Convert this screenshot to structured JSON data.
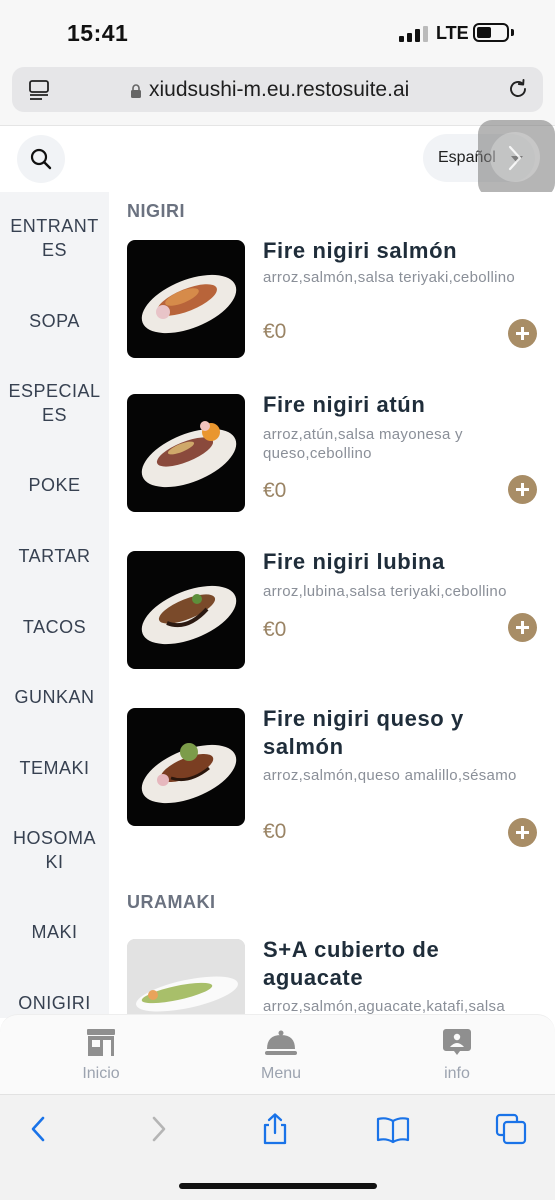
{
  "status_bar": {
    "time": "15:41",
    "network": "LTE"
  },
  "browser": {
    "url": "xiudsushi-m.eu.restosuite.ai"
  },
  "toolbar": {
    "language": "Español"
  },
  "categories": [
    "ENTRANT\nES",
    "SOPA",
    "ESPECIAL\nES",
    "POKE",
    "TARTAR",
    "TACOS",
    "GUNKAN",
    "TEMAKI",
    "HOSOMA\nKI",
    "MAKI",
    "ONIGIRI"
  ],
  "sections": [
    {
      "title": "NIGIRI",
      "items": [
        {
          "name": "Fire nigiri salmón",
          "description": "arroz,salmón,salsa teriyaki,cebollino",
          "price": "€0"
        },
        {
          "name": "Fire nigiri atún",
          "description": "arroz,atún,salsa mayonesa y queso,cebollino",
          "price": "€0"
        },
        {
          "name": "Fire nigiri lubina",
          "description": "arroz,lubina,salsa teriyaki,cebollino",
          "price": "€0"
        },
        {
          "name": "Fire nigiri queso y salmón",
          "description": "arroz,salmón,queso amalillo,sésamo",
          "price": "€0"
        }
      ]
    },
    {
      "title": "URAMAKI",
      "items": [
        {
          "name": "S+A cubierto de aguacate",
          "description": "arroz,salmón,aguacate,katafi,salsa",
          "price": ""
        }
      ]
    }
  ],
  "bottom_nav": [
    {
      "label": "Inicio",
      "icon": "store-icon"
    },
    {
      "label": "Menu",
      "icon": "cloche-icon"
    },
    {
      "label": "info",
      "icon": "info-icon"
    }
  ],
  "colors": {
    "accent": "#a88d66",
    "price": "#9a8465",
    "sidebar_bg": "#f3f4f6",
    "safari_blue": "#1a73e8"
  }
}
